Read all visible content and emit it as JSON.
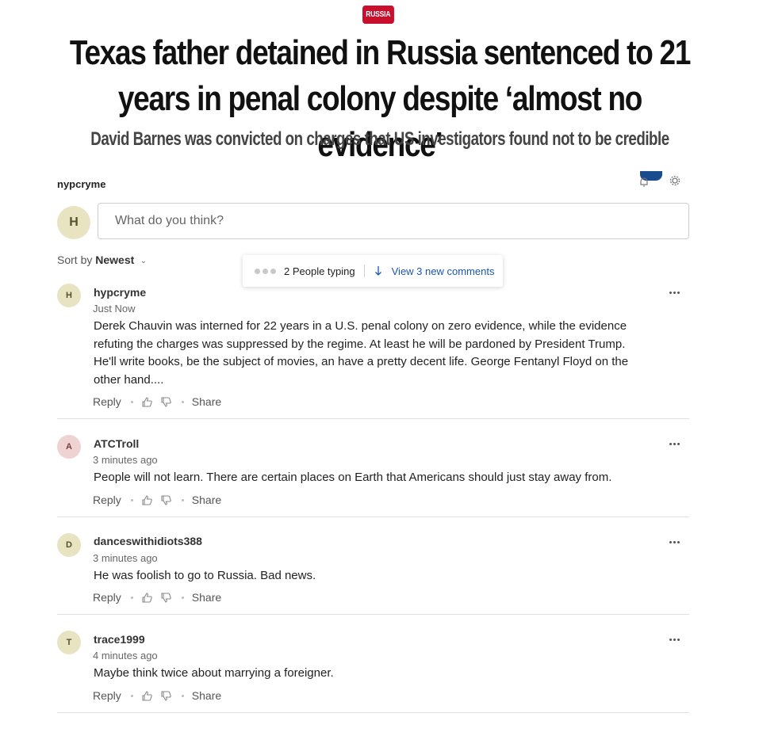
{
  "article": {
    "section": "RUSSIA",
    "headline": "Texas father detained in Russia sentenced to 21 years in penal colony despite ‘almost no evidence’",
    "subheadline": "David Barnes was convicted on charges that US investigators found not to be credible"
  },
  "comments_widget": {
    "current_user": "nypcryme",
    "composer": {
      "avatar_letter": "H",
      "placeholder": "What do you think?"
    },
    "sort": {
      "label": "Sort by",
      "value": "Newest"
    },
    "typing": {
      "text": "2 People typing",
      "new_comments": "View 3 new comments"
    },
    "action_labels": {
      "reply": "Reply",
      "share": "Share"
    },
    "comments": [
      {
        "avatar_letter": "H",
        "avatar_color": "#e8e4c2",
        "username": "hypcryme",
        "time": "Just Now",
        "body": "Derek Chauvin was interned for 22 years in a U.S. penal colony on zero evidence, while the evidence refuting the charges was suppressed by the regime.  At least he will  be pardoned by President Trump.  He'll write books, be the subject of movies, an have a pretty decent life.  George Fentanyl Floyd on the other  hand...."
      },
      {
        "avatar_letter": "A",
        "avatar_color": "#efd3d3",
        "username": "ATCTroll",
        "time": "3 minutes ago",
        "body": "People will not learn.  There are certain places on Earth that Americans should just stay away from."
      },
      {
        "avatar_letter": "D",
        "avatar_color": "#e8e4c2",
        "username": "danceswithidiots388",
        "time": "3 minutes ago",
        "body": "He was foolish to go to Russia.  Bad news."
      },
      {
        "avatar_letter": "T",
        "avatar_color": "#e8e4c2",
        "username": "trace1999",
        "time": "4 minutes ago",
        "body": "Maybe think twice about marrying a foreigner."
      }
    ]
  },
  "colors": {
    "section_red": "#c8102e",
    "link_blue": "#1a56b0",
    "badge_navy": "#1a4b8c"
  },
  "icons": [
    "bell-icon",
    "gear-icon",
    "arrow-down-icon",
    "thumbs-up-icon",
    "thumbs-down-icon",
    "more-icon"
  ]
}
